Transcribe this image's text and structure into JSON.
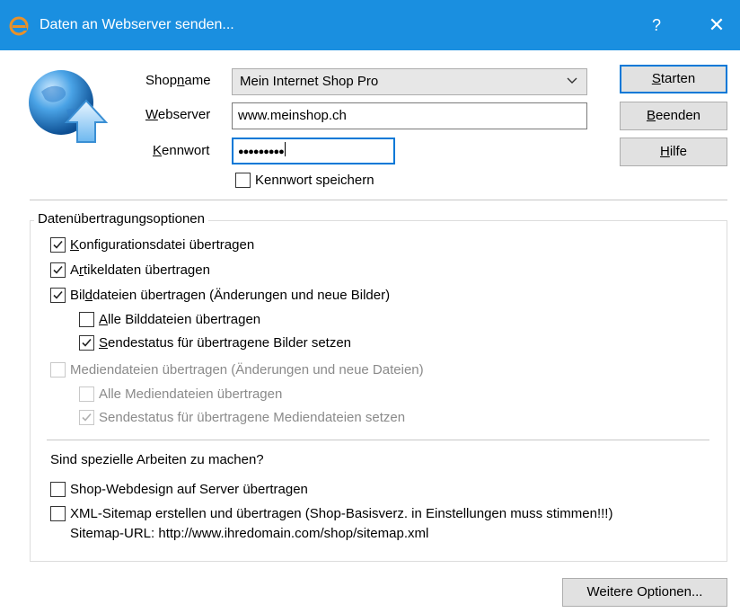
{
  "window": {
    "title": "Daten an Webserver senden...",
    "help_glyph": "?",
    "close_glyph": "✕"
  },
  "icons": {
    "app": "browser-e-icon",
    "globe": "globe-upload-icon",
    "dropdown": "chevron-down-icon"
  },
  "colors": {
    "titlebar": "#1a8fe0",
    "accent": "#0078d7",
    "app_icon": "#e8912a"
  },
  "form": {
    "shopname": {
      "label_pre": "Shop",
      "label_key": "n",
      "label_post": "ame",
      "value": "Mein Internet Shop Pro"
    },
    "webserver": {
      "label_pre": "",
      "label_key": "W",
      "label_post": "ebserver",
      "value": "www.meinshop.ch"
    },
    "kennwort": {
      "label_pre": "",
      "label_key": "K",
      "label_post": "ennwort",
      "value": "●●●●●●●●●"
    },
    "save_password": {
      "label": "Kennwort speichern",
      "checked": false
    }
  },
  "buttons": {
    "start": {
      "pre": "",
      "key": "S",
      "post": "tarten"
    },
    "quit": {
      "pre": "",
      "key": "B",
      "post": "eenden"
    },
    "help": {
      "pre": "",
      "key": "H",
      "post": "ilfe"
    },
    "more": "Weitere Optionen..."
  },
  "options": {
    "caption": "Datenübertragungsoptionen",
    "items": [
      {
        "pre": "",
        "key": "K",
        "post": "onfigurationsdatei übertragen",
        "checked": true,
        "enabled": true
      },
      {
        "pre": "A",
        "key": "r",
        "post": "tikeldaten übertragen",
        "checked": true,
        "enabled": true
      },
      {
        "pre": "Bil",
        "key": "d",
        "post": "dateien übertragen (Änderungen und neue Bilder)",
        "checked": true,
        "enabled": true
      },
      {
        "pre": "",
        "key": "A",
        "post": "lle Bilddateien übertragen",
        "checked": false,
        "enabled": true
      },
      {
        "pre": "",
        "key": "S",
        "post": "endestatus für übertragene Bilder setzen",
        "checked": true,
        "enabled": true
      },
      {
        "pre": "",
        "key": "",
        "post": "Mediendateien übertragen (Änderungen und neue Dateien)",
        "checked": false,
        "enabled": false
      },
      {
        "pre": "",
        "key": "",
        "post": "Alle Mediendateien übertragen",
        "checked": false,
        "enabled": false
      },
      {
        "pre": "",
        "key": "",
        "post": "Sendestatus für übertragene Mediendateien setzen",
        "checked": true,
        "enabled": false
      }
    ],
    "special_heading": "Sind spezielle Arbeiten zu machen?",
    "special": [
      {
        "label": "Shop-Webdesign auf Server übertragen",
        "checked": false
      },
      {
        "label": "XML-Sitemap erstellen und übertragen (Shop-Basisverz. in Einstellungen muss stimmen!!!)",
        "checked": false
      }
    ],
    "sitemap_url": "Sitemap-URL: http://www.ihredomain.com/shop/sitemap.xml"
  }
}
